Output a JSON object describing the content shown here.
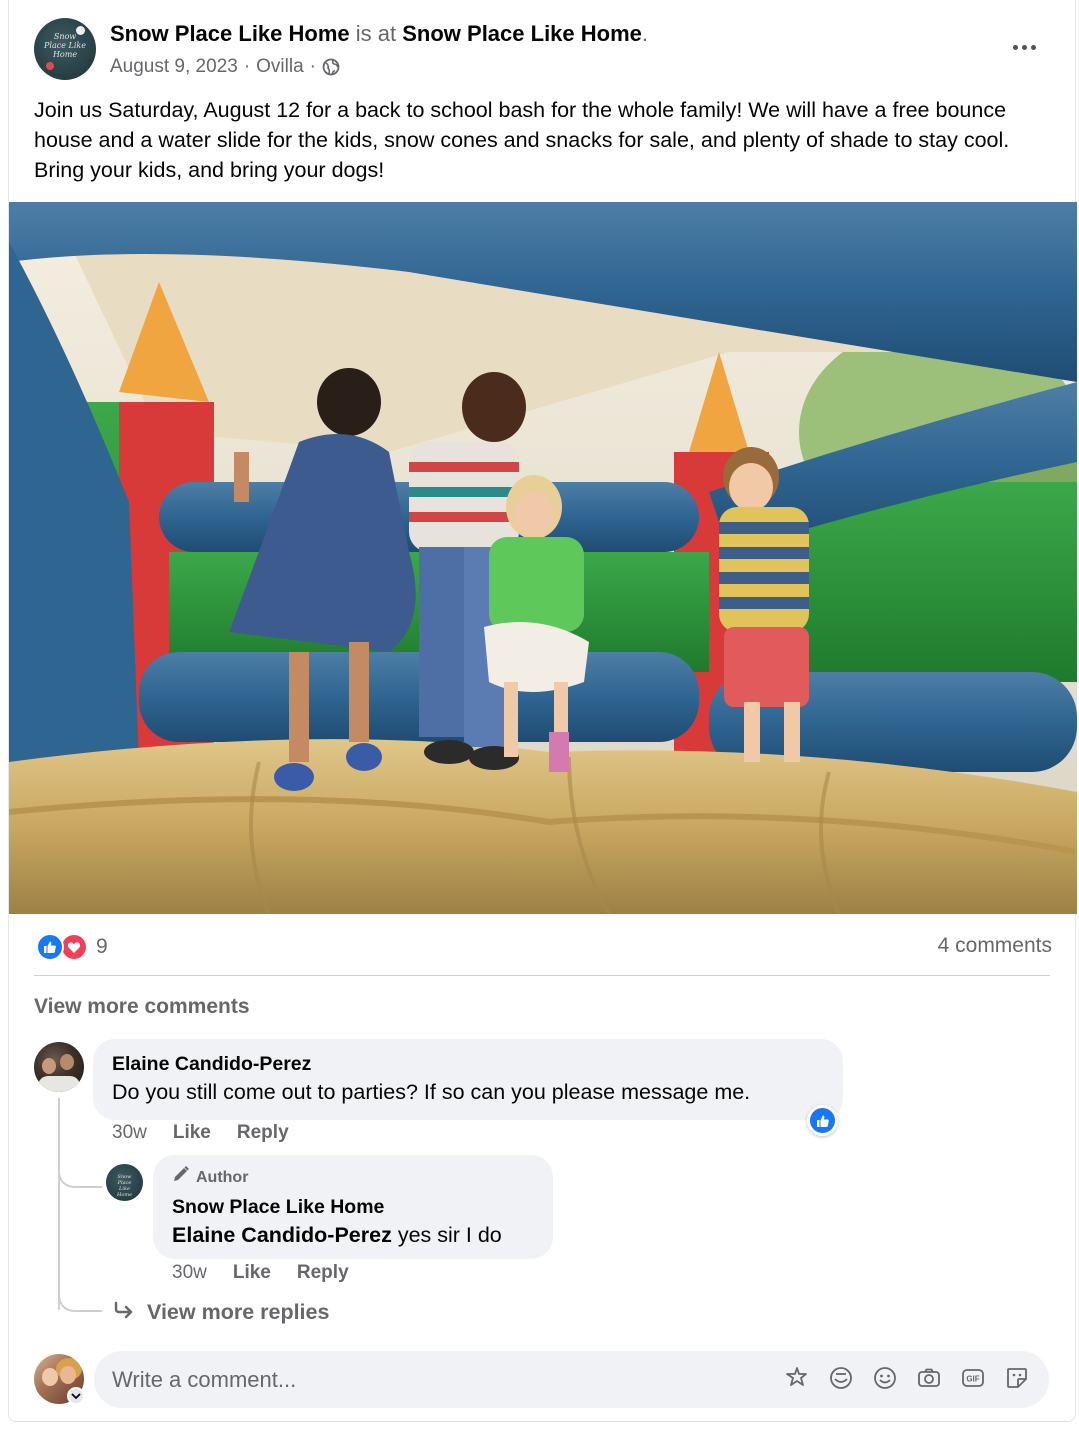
{
  "post": {
    "page_name": "Snow Place Like Home",
    "is_at": "is at",
    "location_name": "Snow Place Like Home",
    "period": ".",
    "date": "August 9, 2023",
    "sep1": "·",
    "place": "Ovilla",
    "sep2": "·",
    "text": "Join us Saturday, August 12 for a back to school bash for the whole family! We will have a free bounce house and a water slide for the kids, snow cones and snacks for sale, and plenty of shade to stay cool. Bring your kids, and bring your dogs!",
    "avatar_logo_text": "Snow Place Like Home",
    "image_alt": "Kids jumping in a bounce house"
  },
  "stats": {
    "reaction_count": "9",
    "comments_label": "4 comments",
    "reactions": [
      "like-icon",
      "love-icon"
    ]
  },
  "comments": {
    "view_more_label": "View more comments",
    "items": [
      {
        "author": "Elaine Candido-Perez",
        "text": "Do you still come out to parties? If so can you please message me.",
        "time": "30w",
        "like": "Like",
        "reply": "Reply",
        "replies": [
          {
            "badge": "Author",
            "author": "Snow Place Like Home",
            "mention": "Elaine Candido-Perez",
            "text": " yes sir I do",
            "time": "30w",
            "like": "Like",
            "reply": "Reply"
          }
        ]
      }
    ],
    "view_more_replies_label": "View more replies"
  },
  "composer": {
    "placeholder": "Write a comment...",
    "icons": [
      "avatar-sticker-icon",
      "sticker-icon",
      "emoji-icon",
      "camera-icon",
      "gif-icon",
      "sticker-square-icon"
    ]
  },
  "colors": {
    "accent": "#1877f2",
    "love": "#f33e58",
    "secondary_text": "#65676b",
    "bubble_bg": "#f0f2f5"
  }
}
